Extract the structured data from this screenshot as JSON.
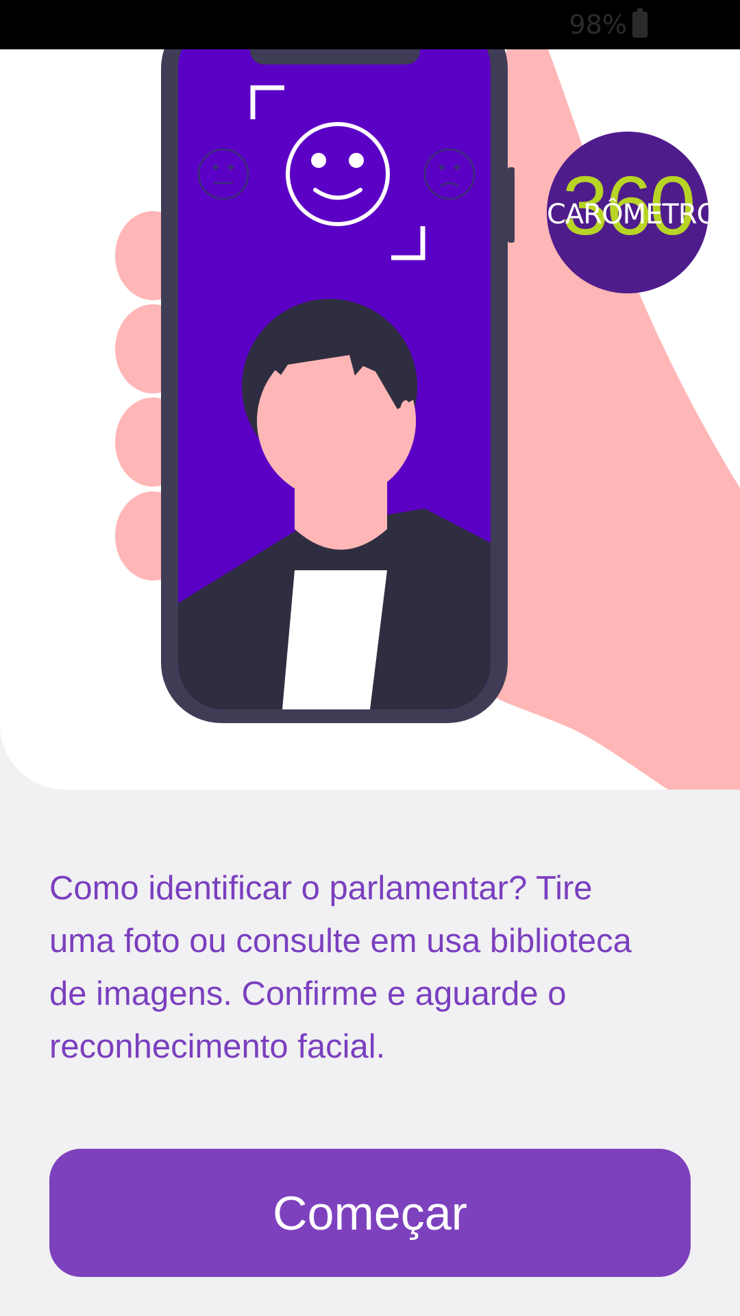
{
  "status_bar": {
    "battery_text": "98%",
    "icon": "battery-icon"
  },
  "hero": {
    "illustration": "hand-holding-phone-face-scan",
    "phone_screen_color": "#5b00c5",
    "hand_color": "#ffb6b6",
    "face_icons": [
      "neutral-face-icon",
      "smiley-face-icon",
      "sad-face-icon"
    ],
    "logo": {
      "number": "360",
      "word": "CARÔMETRO",
      "background": "#4f1c8c",
      "accent": "#b8d424"
    }
  },
  "description": {
    "text": "Como identificar o parlamentar? Tire uma foto ou consulte em usa biblioteca de imagens. Confirme e aguarde o reconhecimento facial."
  },
  "actions": {
    "start_label": "Começar"
  },
  "colors": {
    "accent": "#7d41be",
    "text_accent": "#7a3fbf",
    "background": "#f1f0f2"
  }
}
